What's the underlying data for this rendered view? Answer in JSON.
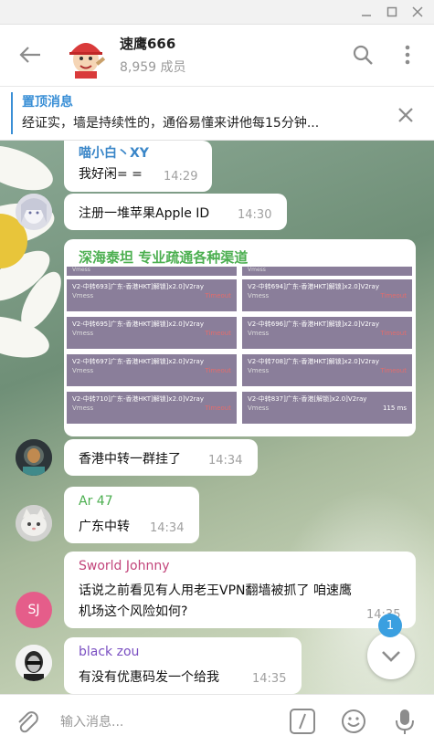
{
  "window": {
    "minimize": "—",
    "maximize": "□",
    "close": "✕"
  },
  "header": {
    "title": "速鹰666",
    "subtitle": "8,959 成员",
    "icons": [
      "back-arrow-icon",
      "search-icon",
      "more-vertical-icon"
    ]
  },
  "pinned": {
    "title": "置顶消息",
    "text": "经证实，墙是持续性的，通俗易懂来讲他每15分钟..."
  },
  "messages": [
    {
      "sender": "喵小白丶XY",
      "text": "我好闲= =",
      "time": "14:29",
      "sender_color": "#3a86c8"
    },
    {
      "text": "注册一堆苹果Apple ID",
      "time": "14:30"
    },
    {
      "sender": "深海泰坦 专业疏通各种渠道",
      "sender_color": "#4caf50",
      "cards": [
        {
          "name": "V2-中转693]广东-香港HKT]解锁]x2.0]V2ray",
          "proto": "Vmess",
          "status": "Timeout"
        },
        {
          "name": "V2-中转694]广东-香港HKT]解锁]x2.0]V2ray",
          "proto": "Vmess",
          "status": "Timeout"
        },
        {
          "name": "V2-中转695]广东-香港HKT]解锁]x2.0]V2ray",
          "proto": "Vmess",
          "status": "Timeout"
        },
        {
          "name": "V2-中转696]广东-香港HKT]解锁]x2.0]V2ray",
          "proto": "Vmess",
          "status": "Timeout"
        },
        {
          "name": "V2-中转697]广东-香港HKT]解锁]x2.0]V2ray",
          "proto": "Vmess",
          "status": "Timeout"
        },
        {
          "name": "V2-中转708]广东-香港HKT]解锁]x2.0]V2ray",
          "proto": "Vmess",
          "status": "Timeout"
        },
        {
          "name": "V2-中转710]广东-香港HKT]解锁]x2.0]V2ray",
          "proto": "Vmess",
          "status": "Timeout"
        },
        {
          "name": "V2-中转837]广东-香港[解锁]x2.0]V2ray",
          "proto": "Vmess",
          "status": "115 ms"
        }
      ]
    },
    {
      "text": "香港中转一群挂了",
      "time": "14:34"
    },
    {
      "sender": "Ar 47",
      "text": "广东中转",
      "time": "14:34",
      "sender_color": "#4caf50"
    },
    {
      "sender": "Sworld Johnny",
      "text": "话说之前看见有人用老王VPN翻墙被抓了  咱速鹰",
      "text2": "机场这个风险如何?",
      "time": "14:35",
      "sender_color": "#c2447a",
      "avatar_initials": "SJ"
    },
    {
      "sender": "black zou",
      "text": "有没有优惠码发一个给我",
      "time": "14:35",
      "sender_color": "#7a4fc2"
    }
  ],
  "scroll": {
    "badge": "1"
  },
  "input": {
    "placeholder": "输入消息..."
  }
}
